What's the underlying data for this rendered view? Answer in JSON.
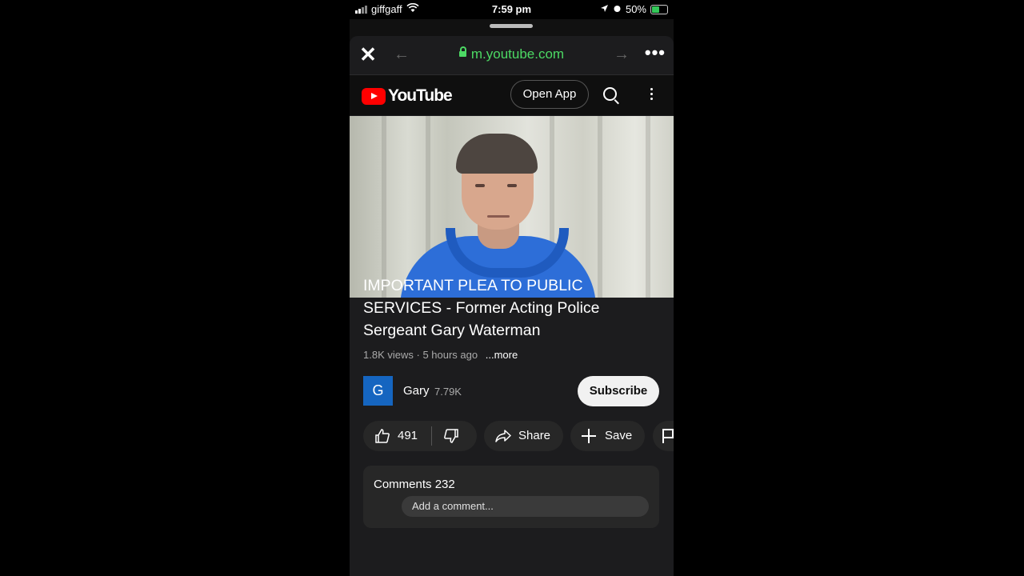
{
  "status_bar": {
    "carrier": "giffgaff",
    "time": "7:59 pm",
    "battery": "50%"
  },
  "browser": {
    "url": "m.youtube.com",
    "close_icon": "close-icon",
    "more_icon": "more-horizontal-icon"
  },
  "youtube_header": {
    "logo_text": "YouTube",
    "open_app_label": "Open App",
    "brand_color": "#ff0000"
  },
  "video": {
    "title": "IMPORTANT PLEA TO PUBLIC SERVICES - Former Acting Police Sergeant Gary Waterman",
    "views": "1.8K views",
    "age": "5 hours ago",
    "more_label": "...more"
  },
  "channel": {
    "avatar_letter": "G",
    "name": "Gary",
    "subscribers": "7.79K",
    "subscribe_label": "Subscribe"
  },
  "actions": {
    "like_count": "491",
    "share_label": "Share",
    "save_label": "Save"
  },
  "comments": {
    "label": "Comments",
    "count": "232",
    "placeholder": "Add a comment..."
  }
}
